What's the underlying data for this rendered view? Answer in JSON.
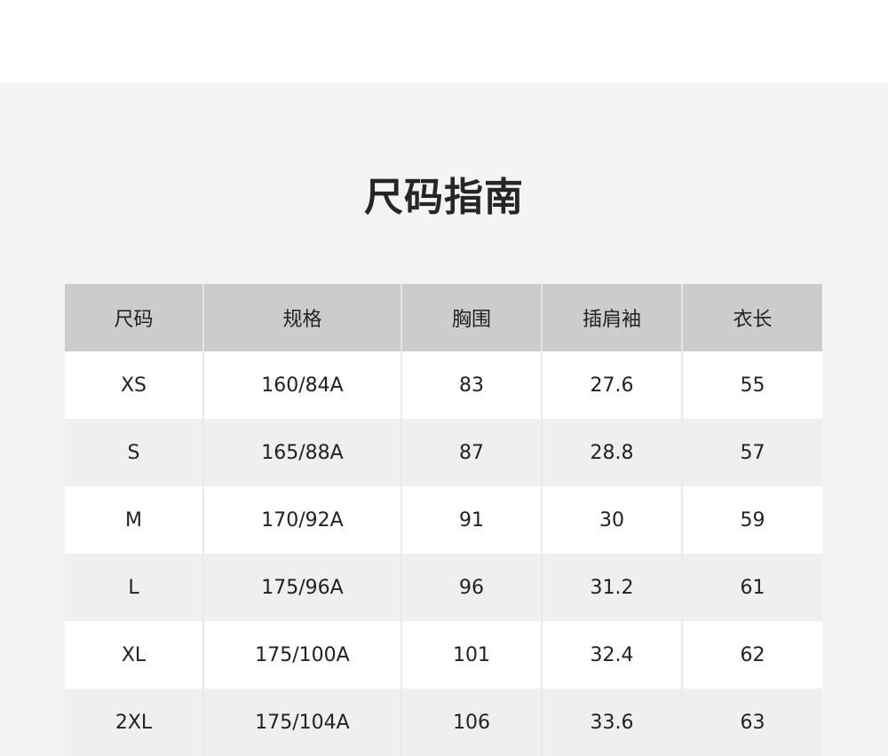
{
  "page": {
    "title": "尺码指南"
  },
  "size_table": {
    "headers": [
      "尺码",
      "规格",
      "胸围",
      "插肩袖",
      "衣长"
    ],
    "rows": [
      [
        "XS",
        "160/84A",
        "83",
        "27.6",
        "55"
      ],
      [
        "S",
        "165/88A",
        "87",
        "28.8",
        "57"
      ],
      [
        "M",
        "170/92A",
        "91",
        "30",
        "59"
      ],
      [
        "L",
        "175/96A",
        "96",
        "31.2",
        "61"
      ],
      [
        "XL",
        "175/100A",
        "101",
        "32.4",
        "62"
      ],
      [
        "2XL",
        "175/104A",
        "106",
        "33.6",
        "63"
      ]
    ]
  }
}
